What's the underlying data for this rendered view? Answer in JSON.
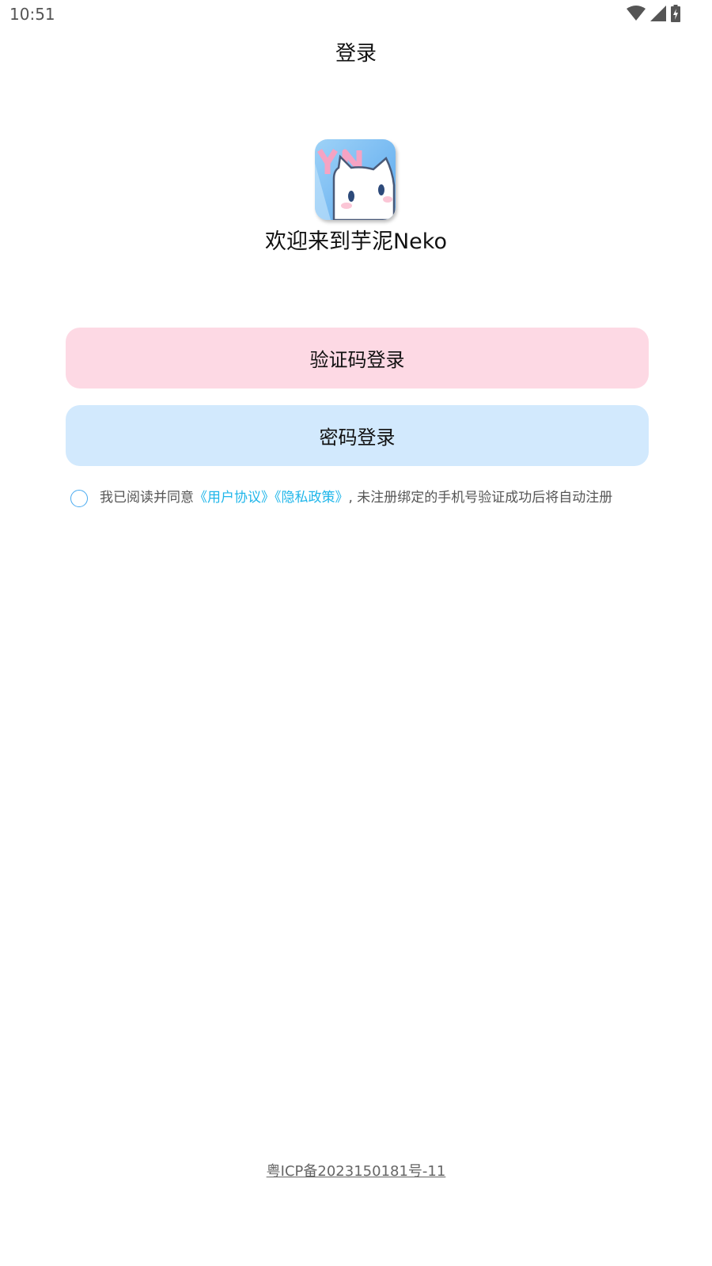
{
  "status_bar": {
    "time": "10:51",
    "icons": [
      "wifi-icon",
      "signal-icon",
      "battery-charging-icon"
    ]
  },
  "header": {
    "title": "登录"
  },
  "app": {
    "logo_icon": "app-logo-icon",
    "welcome_text": "欢迎来到芋泥Neko"
  },
  "buttons": {
    "sms_login": "验证码登录",
    "password_login": "密码登录"
  },
  "agreement": {
    "prefix": "我已阅读并同意",
    "user_agreement": "《用户协议》",
    "privacy_policy": "《隐私政策》",
    "suffix": ", 未注册绑定的手机号验证成功后将自动注册",
    "checked": false
  },
  "footer": {
    "icp": "粤ICP备2023150181号-11"
  },
  "colors": {
    "sms_button_bg": "#fdd9e4",
    "password_button_bg": "#d2e9fd",
    "link": "#1fb6ea"
  }
}
